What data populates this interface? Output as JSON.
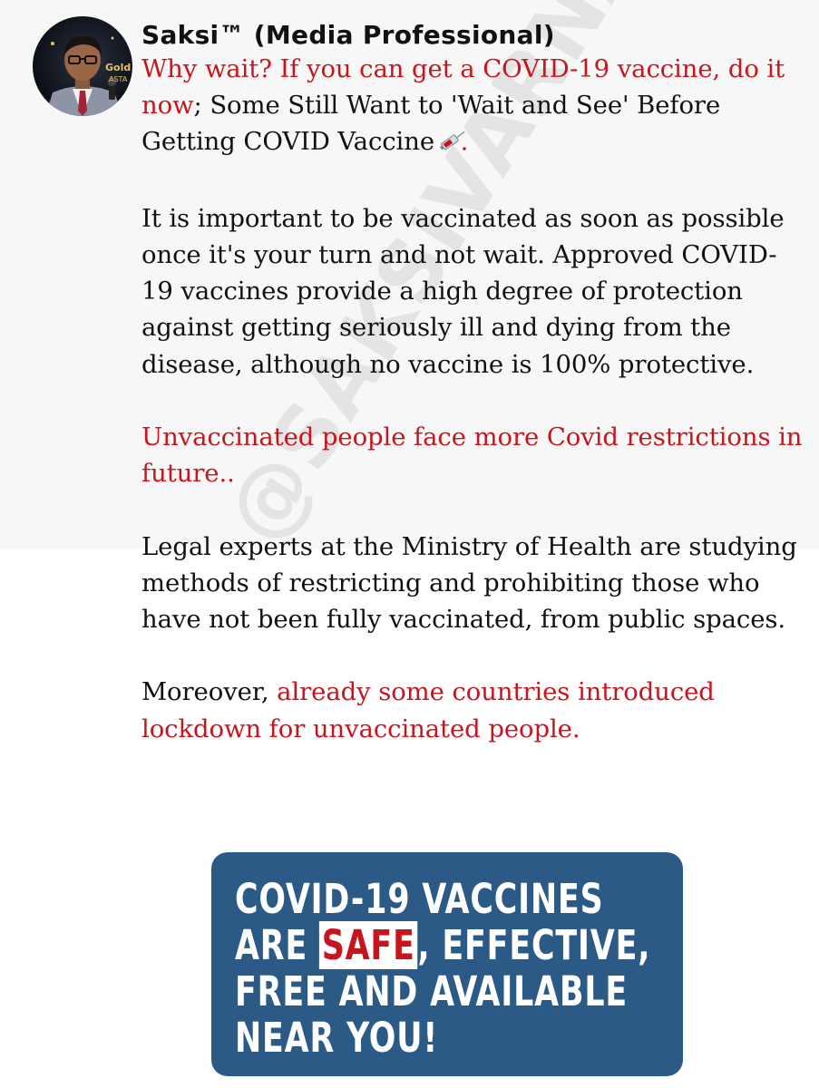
{
  "watermark": "@SAKSIVARNAN",
  "author": {
    "name": "Saksi™ (Media Professional)"
  },
  "avatar": {
    "badge_text": "Gold",
    "badge_sub": "ASTA"
  },
  "post": {
    "p1_red": "Why wait? If you can get a COVID-19 vaccine, do it now",
    "p1_black": "; Some Still Want to 'Wait and See' Before Getting COVID Vaccine",
    "p1_icon": "syringe-icon",
    "p2": "It is important to be vaccinated as soon as possible once it's your turn and not wait. Approved COVID-19 vaccines provide a high degree of protection against getting seriously ill and dying from the disease, although no vaccine is 100% protective.",
    "p3": "Unvaccinated people face more Covid restrictions in future..",
    "p4": "Legal experts at the Ministry of Health are studying methods of restricting and prohibiting those who have not been fully vaccinated, from public spaces.",
    "p5_black": "Moreover, ",
    "p5_red": "already some countries introduced lockdown for unvaccinated people."
  },
  "banner": {
    "line1": "COVID-19 VACCINES",
    "line2_a": "ARE ",
    "line2_safe": "SAFE",
    "line2_b": ", EFFECTIVE,",
    "line3": "FREE AND AVAILABLE",
    "line4": "NEAR YOU!"
  },
  "colors": {
    "highlight_red": "#c8151d",
    "banner_blue": "#2b5a87",
    "text": "#111111"
  }
}
